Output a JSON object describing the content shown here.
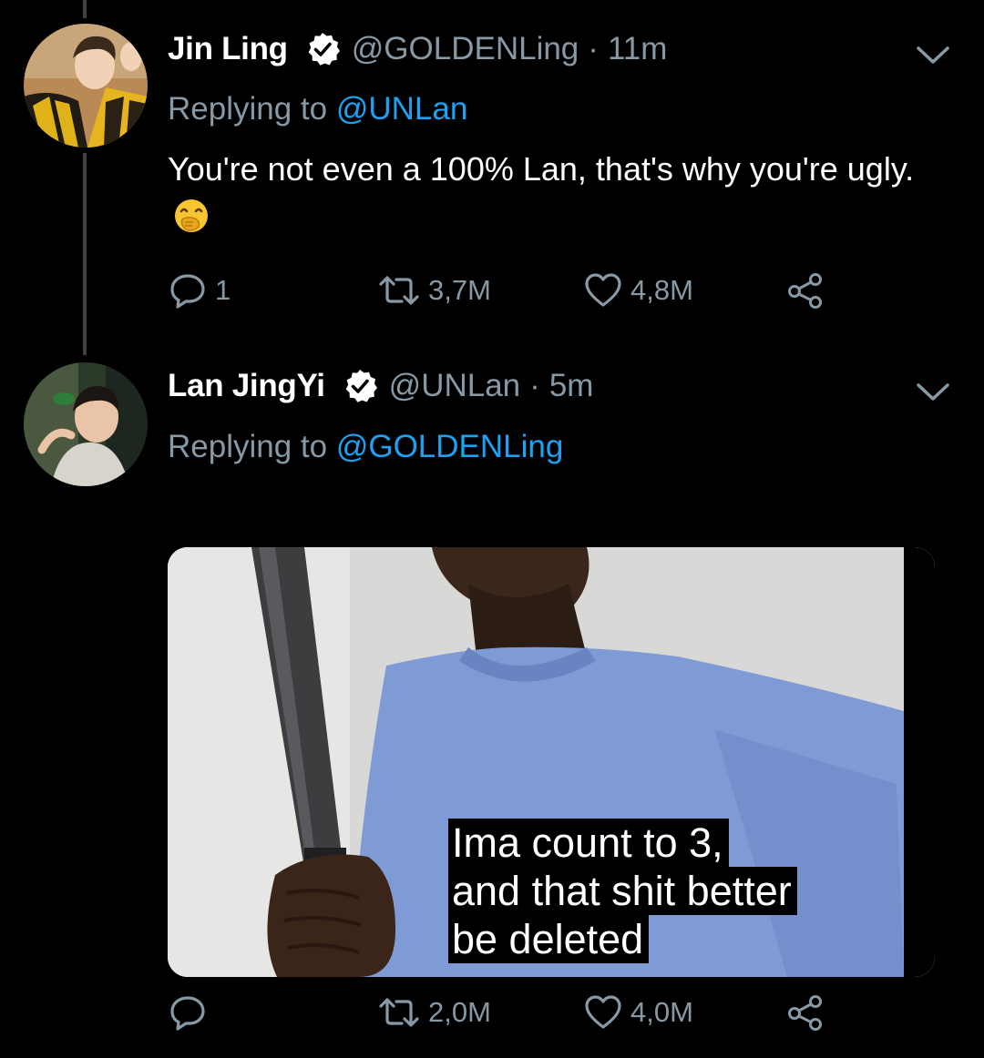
{
  "tweets": [
    {
      "display_name": "Jin Ling",
      "handle": "@GOLDENLing",
      "separator": "·",
      "time": "11m",
      "replying_prefix": "Replying to ",
      "replying_to": "@UNLan",
      "text": "You're not even a 100% Lan, that's why you're ugly.",
      "emoji": "face-with-hand-over-mouth",
      "replies": "1",
      "retweets": "3,7M",
      "likes": "4,8M"
    },
    {
      "display_name": "Lan JingYi",
      "handle": "@UNLan",
      "separator": "·",
      "time": "5m",
      "replying_prefix": "Replying to ",
      "replying_to": "@GOLDENLing",
      "media_caption": [
        "Ima count to 3,",
        "and that shit better",
        "be deleted"
      ],
      "replies": "",
      "retweets": "2,0M",
      "likes": "4,0M"
    }
  ],
  "icons": {
    "verified": "verified-badge-icon",
    "caret": "chevron-down-icon",
    "reply": "reply-icon",
    "retweet": "retweet-icon",
    "like": "heart-icon",
    "share": "share-icon"
  },
  "colors": {
    "background": "#000000",
    "text": "#ffffff",
    "muted": "#8899a6",
    "link": "#1da1f2",
    "thread_line": "#3d4247"
  }
}
